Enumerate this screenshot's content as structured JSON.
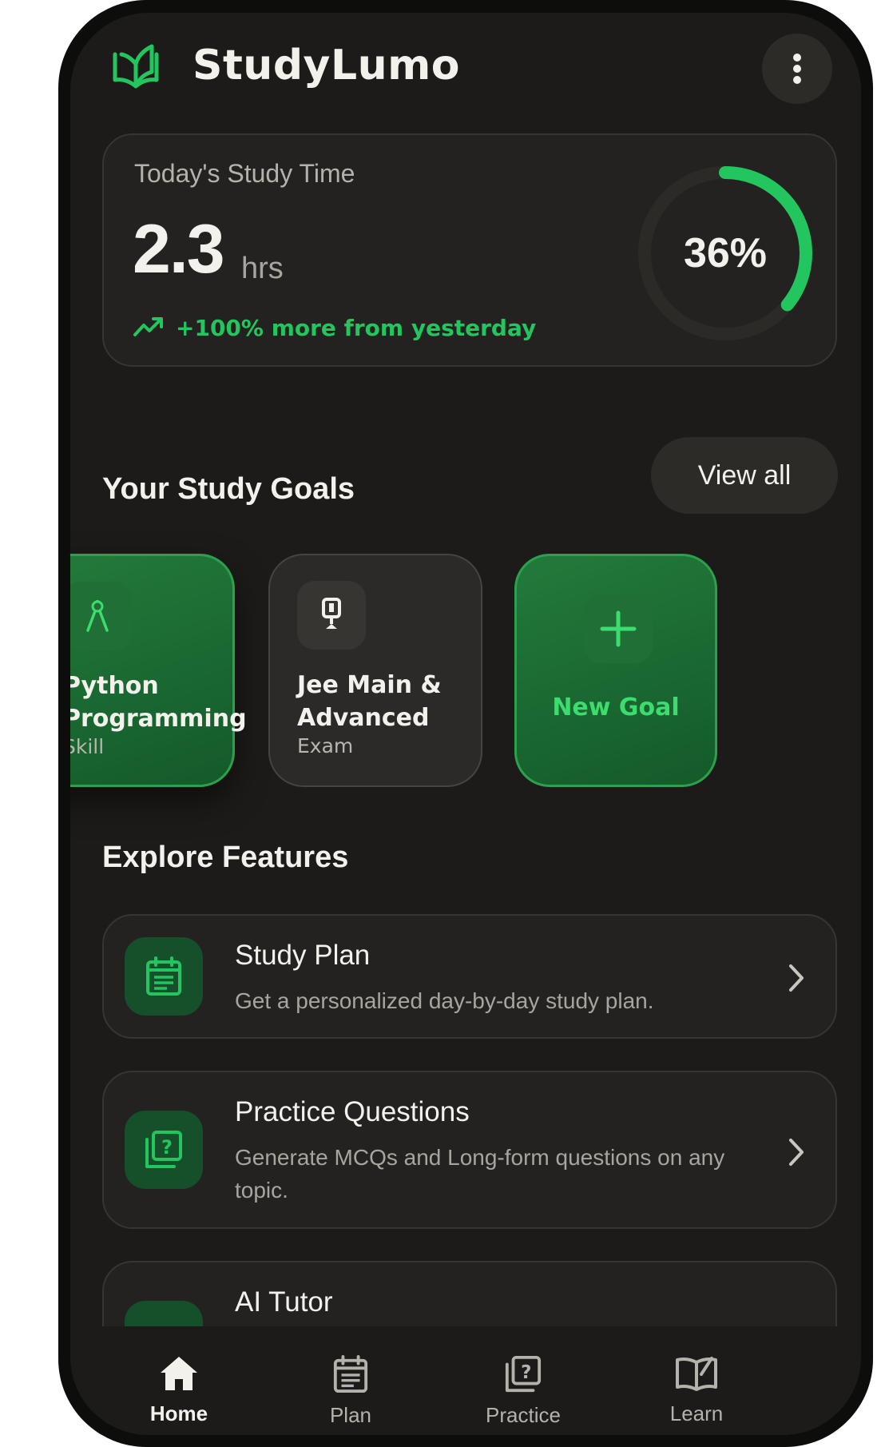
{
  "app": {
    "title": "StudyLumo"
  },
  "study_time": {
    "label": "Today's Study Time",
    "value": "2.3",
    "unit": "hrs",
    "change": "+100% more from yesterday",
    "progress_label": "36%",
    "progress_fraction": 0.36
  },
  "goals": {
    "title": "Your Study Goals",
    "view_all": "View all",
    "items": [
      {
        "name_line1": "Python",
        "name_line2": "Programming",
        "type": "Skill"
      },
      {
        "name_line1": "Jee Main &",
        "name_line2": "Advanced",
        "type": "Exam"
      }
    ],
    "new_goal": "New Goal"
  },
  "features": {
    "title": "Explore Features",
    "items": [
      {
        "name": "Study Plan",
        "desc": "Get a personalized day-by-day study plan."
      },
      {
        "name": "Practice Questions",
        "desc": "Generate MCQs and Long-form questions on any topic."
      },
      {
        "name": "AI Tutor",
        "desc": ""
      }
    ]
  },
  "nav": {
    "items": [
      {
        "label": "Home",
        "icon": "home-icon"
      },
      {
        "label": "Plan",
        "icon": "calendar-icon"
      },
      {
        "label": "Practice",
        "icon": "question-icon"
      },
      {
        "label": "Learn",
        "icon": "book-icon"
      }
    ]
  },
  "colors": {
    "accent": "#22c55e",
    "background": "#1c1b19",
    "card": "#232220"
  }
}
